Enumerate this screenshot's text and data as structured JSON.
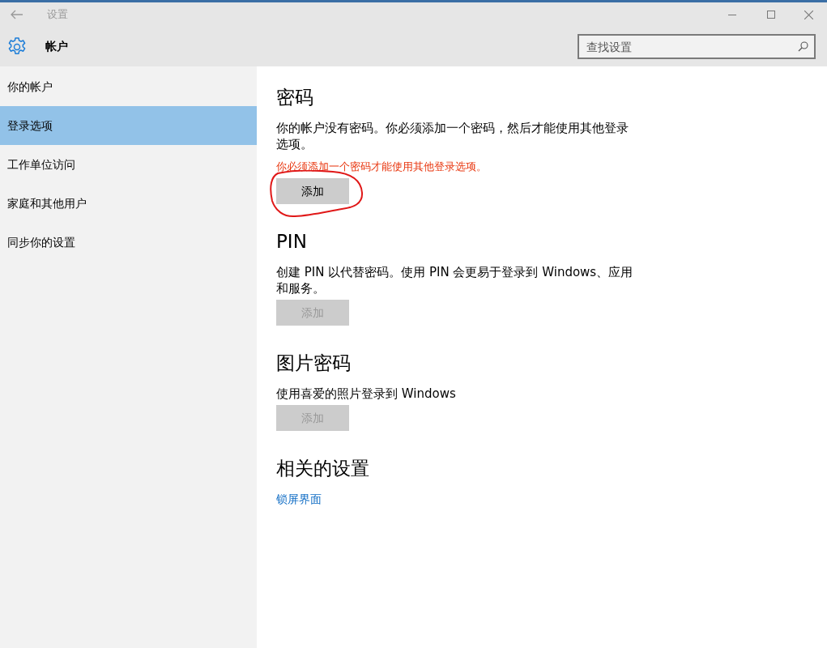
{
  "window": {
    "title": "设置"
  },
  "header": {
    "title": "帐户",
    "search": {
      "placeholder": "查找设置"
    }
  },
  "sidebar": {
    "items": [
      {
        "label": "你的帐户",
        "selected": false
      },
      {
        "label": "登录选项",
        "selected": true
      },
      {
        "label": "工作单位访问",
        "selected": false
      },
      {
        "label": "家庭和其他用户",
        "selected": false
      },
      {
        "label": "同步你的设置",
        "selected": false
      }
    ]
  },
  "sections": [
    {
      "kind": "option",
      "title": "密码",
      "description": "你的帐户没有密码。你必须添加一个密码，然后才能使用其他登录选项。",
      "warning": "你必须添加一个密码才能使用其他登录选项。",
      "button": {
        "label": "添加",
        "disabled": false
      },
      "circled": true
    },
    {
      "kind": "option",
      "title": "PIN",
      "description": "创建 PIN 以代替密码。使用 PIN 会更易于登录到 Windows、应用和服务。",
      "button": {
        "label": "添加",
        "disabled": true
      }
    },
    {
      "kind": "option",
      "title": "图片密码",
      "description": "使用喜爱的照片登录到 Windows",
      "button": {
        "label": "添加",
        "disabled": true
      }
    },
    {
      "kind": "links",
      "title": "相关的设置",
      "links": [
        "锁屏界面"
      ]
    }
  ]
}
